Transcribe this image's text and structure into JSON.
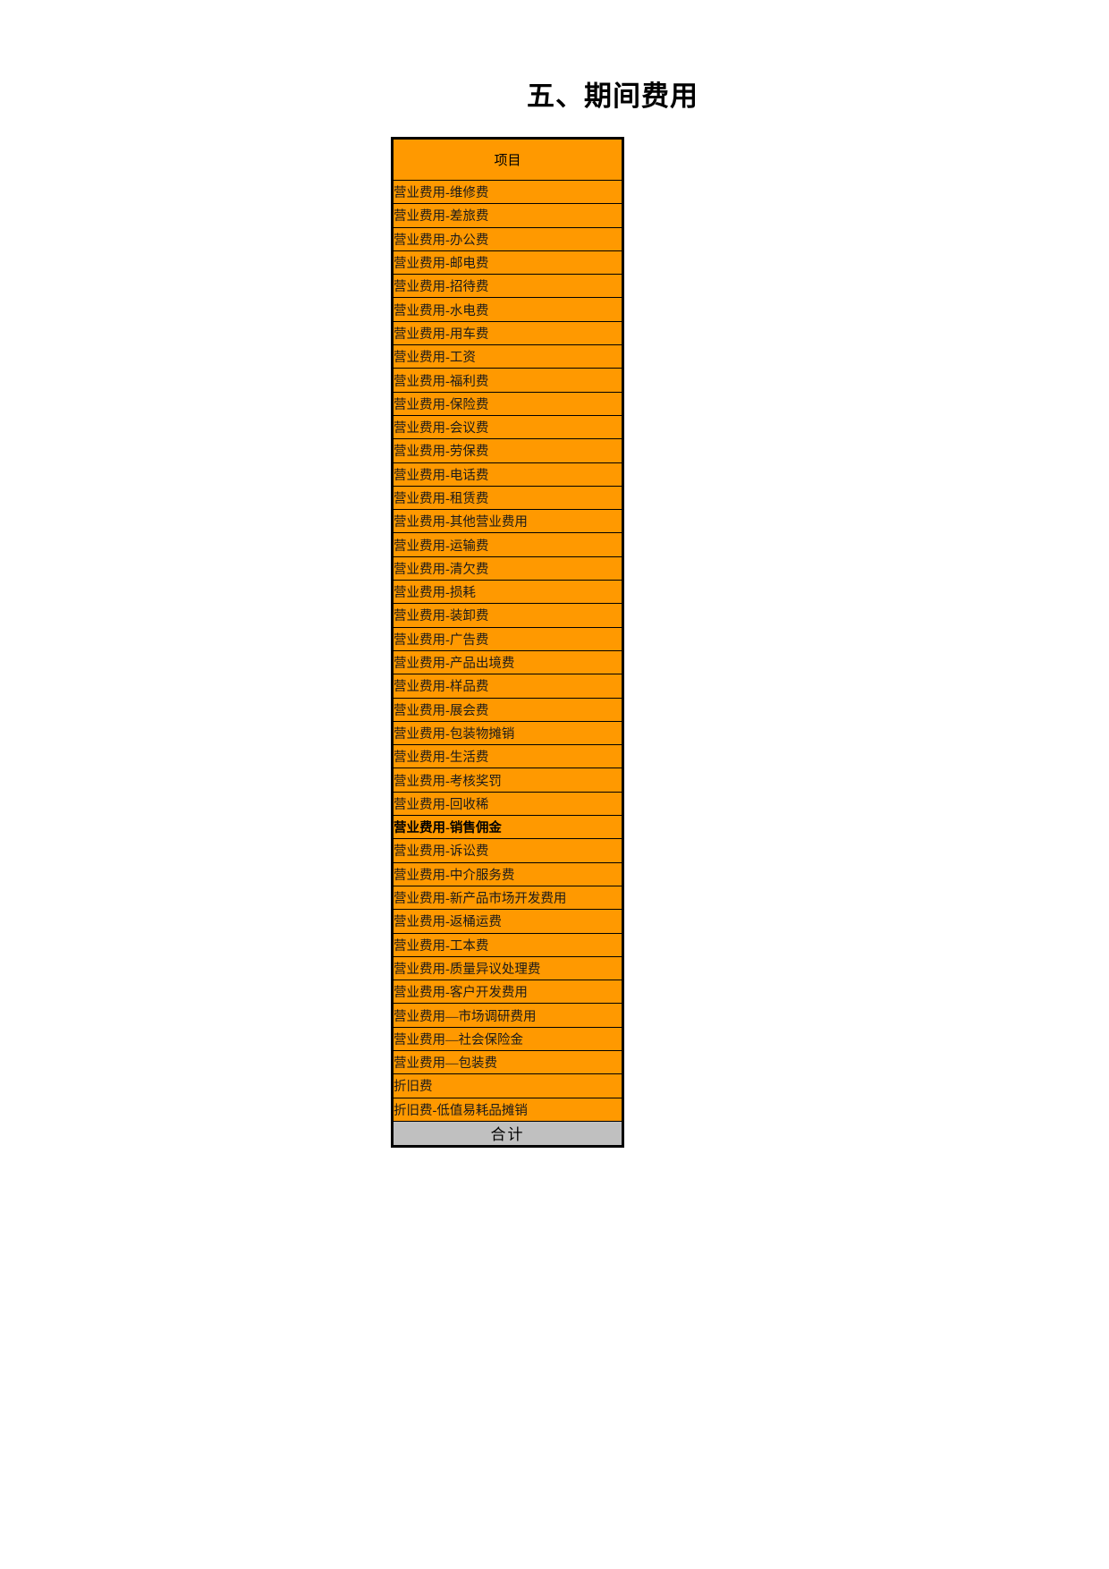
{
  "document": {
    "title": "五、期间费用"
  },
  "table": {
    "header": "项目",
    "total_label": "合计",
    "colors": {
      "row_background": "#FF9900",
      "total_background": "#C0C0C0",
      "border": "#000000",
      "text": "#000000"
    },
    "rows": [
      {
        "label": "营业费用-维修费",
        "bold": false
      },
      {
        "label": "营业费用-差旅费",
        "bold": false
      },
      {
        "label": "营业费用-办公费",
        "bold": false
      },
      {
        "label": "营业费用-邮电费",
        "bold": false
      },
      {
        "label": "营业费用-招待费",
        "bold": false
      },
      {
        "label": "营业费用-水电费",
        "bold": false
      },
      {
        "label": "营业费用-用车费",
        "bold": false
      },
      {
        "label": "营业费用-工资",
        "bold": false
      },
      {
        "label": "营业费用-福利费",
        "bold": false
      },
      {
        "label": "营业费用-保险费",
        "bold": false
      },
      {
        "label": "营业费用-会议费",
        "bold": false
      },
      {
        "label": "营业费用-劳保费",
        "bold": false
      },
      {
        "label": "营业费用-电话费",
        "bold": false
      },
      {
        "label": "营业费用-租赁费",
        "bold": false
      },
      {
        "label": "营业费用-其他营业费用",
        "bold": false
      },
      {
        "label": "营业费用-运输费",
        "bold": false
      },
      {
        "label": "营业费用-清欠费",
        "bold": false
      },
      {
        "label": "营业费用-损耗",
        "bold": false
      },
      {
        "label": "营业费用-装卸费",
        "bold": false
      },
      {
        "label": "营业费用-广告费",
        "bold": false
      },
      {
        "label": "营业费用-产品出境费",
        "bold": false
      },
      {
        "label": "营业费用-样品费",
        "bold": false
      },
      {
        "label": "营业费用-展会费",
        "bold": false
      },
      {
        "label": "营业费用-包装物摊销",
        "bold": false
      },
      {
        "label": "营业费用-生活费",
        "bold": false
      },
      {
        "label": "营业费用-考核奖罚",
        "bold": false
      },
      {
        "label": "营业费用-回收稀",
        "bold": false
      },
      {
        "label": "营业费用-销售佣金",
        "bold": true
      },
      {
        "label": "营业费用-诉讼费",
        "bold": false
      },
      {
        "label": "营业费用-中介服务费",
        "bold": false
      },
      {
        "label": "营业费用-新产品市场开发费用",
        "bold": false
      },
      {
        "label": "营业费用-返桶运费",
        "bold": false
      },
      {
        "label": "营业费用-工本费",
        "bold": false
      },
      {
        "label": "营业费用-质量异议处理费",
        "bold": false
      },
      {
        "label": "营业费用-客户开发费用",
        "bold": false
      },
      {
        "label": "营业费用—市场调研费用",
        "bold": false
      },
      {
        "label": "营业费用—社会保险金",
        "bold": false
      },
      {
        "label": "营业费用—包装费",
        "bold": false
      },
      {
        "label": "折旧费",
        "bold": false
      },
      {
        "label": "折旧费-低值易耗品摊销",
        "bold": false
      }
    ]
  }
}
